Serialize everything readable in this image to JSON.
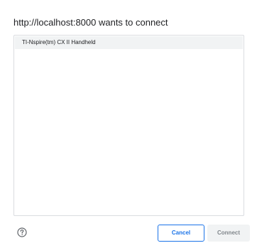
{
  "dialog": {
    "title": "http://localhost:8000 wants to connect",
    "devices": [
      {
        "label": "TI-Nspire(tm) CX II Handheld"
      }
    ],
    "help_icon": "help-circle-icon",
    "cancel_label": "Cancel",
    "connect_label": "Connect",
    "connect_enabled": false
  },
  "colors": {
    "accent": "#1a73e8",
    "disabled_text": "#80868b",
    "list_border": "#dadce0",
    "selected_bg": "#f1f3f4"
  }
}
